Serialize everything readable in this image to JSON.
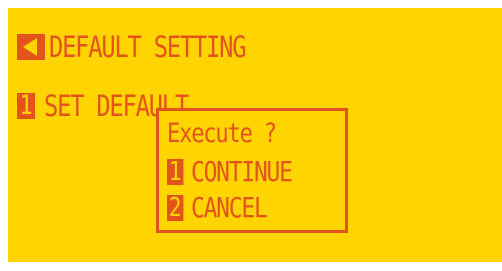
{
  "screen": {
    "title": "DEFAULT SETTING",
    "back_icon": "back-arrow-icon",
    "item": {
      "number": "1",
      "label": "SET DEFAULT"
    }
  },
  "dialog": {
    "title": "Execute ?",
    "options": [
      {
        "number": "1",
        "label": "CONTINUE"
      },
      {
        "number": "2",
        "label": "CANCEL"
      }
    ]
  },
  "colors": {
    "background": "#ffd400",
    "accent": "#e3541d"
  }
}
